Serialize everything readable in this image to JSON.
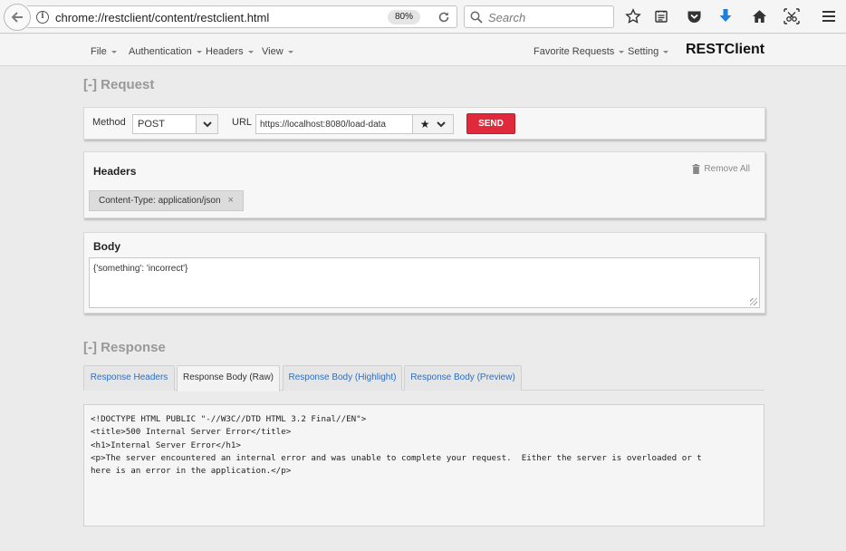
{
  "browser": {
    "url": "chrome://restclient/content/restclient.html",
    "zoom": "80%",
    "search_placeholder": "Search"
  },
  "nav": {
    "left_menus": [
      "File",
      "Authentication",
      "Headers",
      "View"
    ],
    "right_menus": [
      "Favorite Requests",
      "Setting"
    ],
    "brand": "RESTClient"
  },
  "request": {
    "section_title": "[-] Request",
    "method_label": "Method",
    "method_value": "POST",
    "url_label": "URL",
    "url_value": "https://localhost:8080/load-data",
    "send_label": "SEND"
  },
  "headers": {
    "title": "Headers",
    "remove_all_label": "Remove All",
    "items": [
      "Content-Type: application/json"
    ],
    "close_glyph": "×"
  },
  "body": {
    "title": "Body",
    "value": "{'something': 'incorrect'}"
  },
  "response": {
    "section_title": "[-] Response",
    "tabs": [
      "Response Headers",
      "Response Body (Raw)",
      "Response Body (Highlight)",
      "Response Body (Preview)"
    ],
    "active_tab": "Response Body (Raw)",
    "lines": [
      "<!DOCTYPE HTML PUBLIC \"-//W3C//DTD HTML 3.2 Final//EN\">",
      "<title>500 Internal Server Error</title>",
      "<h1>Internal Server Error</h1>",
      "<p>The server encountered an internal error and was unable to complete your request.  Either the server is overloaded or t",
      "here is an error in the application.</p>"
    ]
  },
  "colors": {
    "send_button": "#e0293a",
    "tab_link": "#2b6fc4",
    "download_arrow": "#1a7fe0"
  }
}
